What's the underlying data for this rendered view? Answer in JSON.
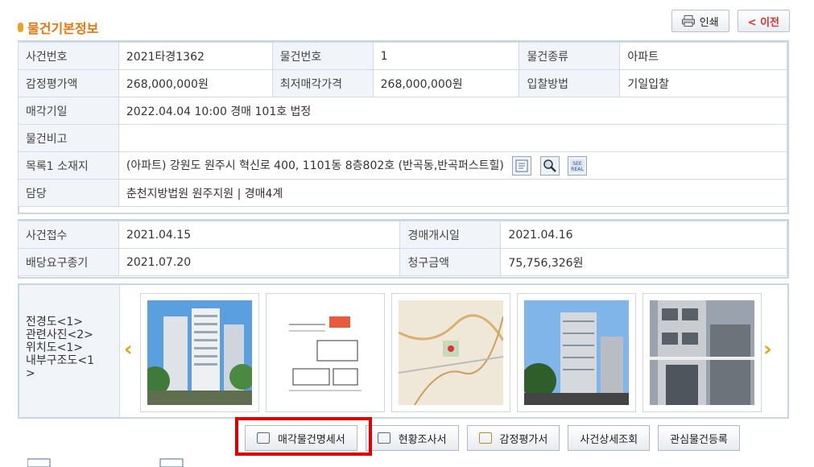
{
  "section_title": "물건기본정보",
  "top_buttons": {
    "print": "인쇄",
    "back": "< 이전"
  },
  "table1": {
    "case_no_label": "사건번호",
    "case_no": "2021타경1362",
    "item_no_label": "물건번호",
    "item_no": "1",
    "item_type_label": "물건종류",
    "item_type": "아파트",
    "appraisal_label": "감정평가액",
    "appraisal": "268,000,000원",
    "min_price_label": "최저매각가격",
    "min_price": "268,000,000원",
    "bid_method_label": "입찰방법",
    "bid_method": "기일입찰",
    "sale_date_label": "매각기일",
    "sale_date": "2022.04.04 10:00 경매 101호 법정",
    "remarks_label": "물건비고",
    "remarks": "",
    "location_label": "목록1 소재지",
    "location": "(아파트) 강원도 원주시 혁신로 400, 1101동 8층802호 (반곡동,반곡퍼스트힐)",
    "charge_label": "담당",
    "charge": "춘천지방법원 원주지원 | 경매4계"
  },
  "table2": {
    "receipt_label": "사건접수",
    "receipt": "2021.04.15",
    "start_label": "경매개시일",
    "start": "2021.04.16",
    "dividend_label": "배당요구종기",
    "dividend": "2021.07.20",
    "claim_label": "청구금액",
    "claim": "75,756,326원"
  },
  "photos": {
    "labels": [
      "전경도<1>",
      "관련사진<2>",
      "위치도<1>",
      "내부구조도<1",
      ">"
    ]
  },
  "bottom_buttons": {
    "sale_spec": "매각물건명세서",
    "status_report": "현황조사서",
    "appraisal_report": "감정평가서",
    "case_detail": "사건상세조회",
    "watch": "관심물건등록"
  }
}
